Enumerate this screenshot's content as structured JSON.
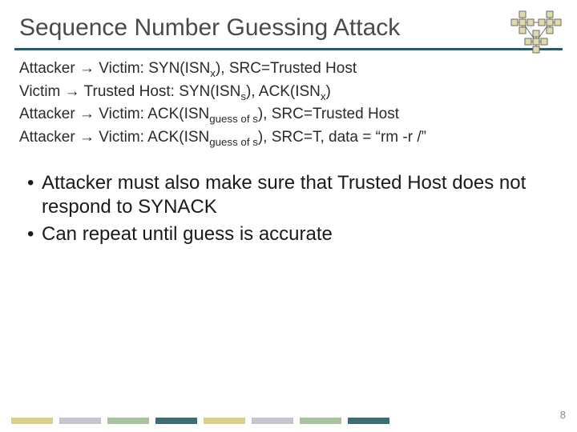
{
  "title": "Sequence Number Guessing Attack",
  "lines": [
    {
      "from": "Attacker",
      "to": "Victim",
      "rest_a": "SYN(ISN",
      "sub_a": "x",
      "rest_b": "), SRC=Trusted Host",
      "sub_b": "",
      "rest_c": ""
    },
    {
      "from": "Victim",
      "to": "Trusted Host",
      "rest_a": "SYN(ISN",
      "sub_a": "s",
      "rest_b": "), ACK(ISN",
      "sub_b": "x",
      "rest_c": ")"
    },
    {
      "from": "Attacker",
      "to": "Victim",
      "rest_a": "ACK(ISN",
      "sub_a": "guess of s",
      "rest_b": "), SRC=Trusted Host",
      "sub_b": "",
      "rest_c": ""
    },
    {
      "from": "Attacker",
      "to": "Victim",
      "rest_a": "ACK(ISN",
      "sub_a": "guess of s",
      "rest_b": "), SRC=T, data = “rm -r /”",
      "sub_b": "",
      "rest_c": ""
    }
  ],
  "bullets": [
    "Attacker must also make sure that Trusted Host does not respond to SYNACK",
    "Can repeat until guess is accurate"
  ],
  "page_number": "8",
  "stripe_colors": [
    "#d7d08a",
    "#c9c3d0",
    "#a6c29f",
    "#3b6d74",
    "#d7d08a",
    "#c9c3d0",
    "#a6c29f",
    "#3b6d74"
  ],
  "graphic_node_fill": "#e0dca8",
  "graphic_edge": "#6b6b6b"
}
